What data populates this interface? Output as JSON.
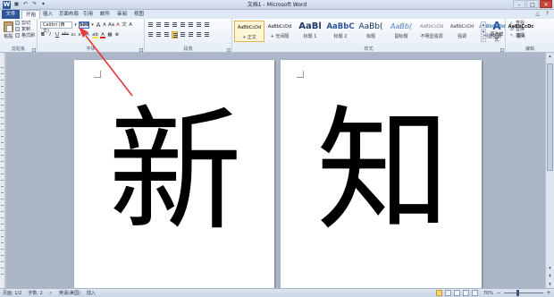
{
  "window": {
    "title": "文档1 - Microsoft Word",
    "app_icon": "W",
    "quick_access": [
      "save-icon",
      "undo-icon",
      "redo-icon",
      "customize-icon"
    ],
    "controls": {
      "minimize": "–",
      "maximize": "□",
      "close": "✕"
    }
  },
  "tabs": [
    {
      "label": "文件"
    },
    {
      "label": "开始"
    },
    {
      "label": "插入"
    },
    {
      "label": "页面布局"
    },
    {
      "label": "引用"
    },
    {
      "label": "邮件"
    },
    {
      "label": "审阅"
    },
    {
      "label": "视图"
    }
  ],
  "ribbon": {
    "clipboard": {
      "paste": "粘贴",
      "cut": "剪切",
      "copy": "复制",
      "format_painter": "格式刷",
      "group_label": "剪贴板"
    },
    "font": {
      "name": "Calibri (西文)",
      "size": "500",
      "grow": "A",
      "shrink": "A",
      "case": "Aa",
      "clear": "A",
      "bold": "B",
      "italic": "I",
      "underline": "U",
      "strike": "abc",
      "subscript": "x₂",
      "superscript": "x²",
      "effects": "A",
      "highlight": "ab",
      "color": "A",
      "border": "A",
      "group_label": "字体"
    },
    "paragraph": {
      "group_label": "段落"
    },
    "styles": {
      "items": [
        {
          "sample": "AaBbCcDd",
          "name": "+ 正文"
        },
        {
          "sample": "AaBbCcDd",
          "name": "+ 无间隔"
        },
        {
          "sample": "AaBl",
          "name": "标题 1"
        },
        {
          "sample": "AaBbC",
          "name": "标题 2"
        },
        {
          "sample": "AaBb(",
          "name": "标题"
        },
        {
          "sample": "AaBb(",
          "name": "副标题"
        },
        {
          "sample": "AaBbCcDd",
          "name": "不明显强调"
        },
        {
          "sample": "AaBbCcDd",
          "name": "强调"
        },
        {
          "sample": "AaBbCcDd",
          "name": "明显强调"
        },
        {
          "sample": "AaBbCcDc",
          "name": "要点"
        }
      ],
      "change_styles": "更改样式",
      "group_label": "样式"
    },
    "editing": {
      "find": "查找",
      "replace": "替换",
      "select": "选择",
      "group_label": "编辑"
    }
  },
  "document": {
    "page1_text": "新",
    "page2_text": "知"
  },
  "statusbar": {
    "page": "页面: 1/2",
    "words": "字数: 2",
    "language": "英语(美国)",
    "mode": "插入",
    "zoom": "70%",
    "zoom_out": "−",
    "zoom_in": "+"
  },
  "colors": {
    "accent": "#2b579a",
    "annotation": "#e53935"
  }
}
